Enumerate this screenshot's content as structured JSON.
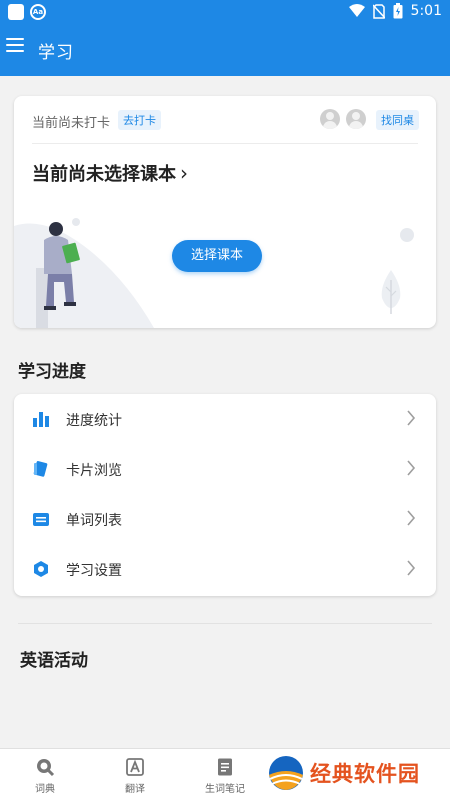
{
  "status_bar": {
    "time": "5:01",
    "app_icon_text": "Aa"
  },
  "app_bar": {
    "title": "学习"
  },
  "checkin": {
    "status_text": "当前尚未打卡",
    "checkin_tag": "去打卡",
    "deskmate_tag": "找同桌"
  },
  "textbook": {
    "title": "当前尚未选择课本",
    "chevron": "›",
    "button_label": "选择课本"
  },
  "progress_section": {
    "title": "学习进度",
    "items": [
      {
        "label": "进度统计",
        "icon": "bar-chart-icon"
      },
      {
        "label": "卡片浏览",
        "icon": "cards-icon"
      },
      {
        "label": "单词列表",
        "icon": "list-box-icon"
      },
      {
        "label": "学习设置",
        "icon": "hexagon-settings-icon"
      }
    ]
  },
  "activities_section": {
    "title": "英语活动"
  },
  "bottom_nav": {
    "items": [
      {
        "label": "词典",
        "icon": "search-icon"
      },
      {
        "label": "翻译",
        "icon": "translate-icon"
      },
      {
        "label": "生词笔记",
        "icon": "notes-icon"
      }
    ]
  },
  "watermark": {
    "text": "经典软件园"
  },
  "colors": {
    "primary": "#1e88e5",
    "background": "#f2f2f2",
    "watermark": "#e4531f"
  }
}
